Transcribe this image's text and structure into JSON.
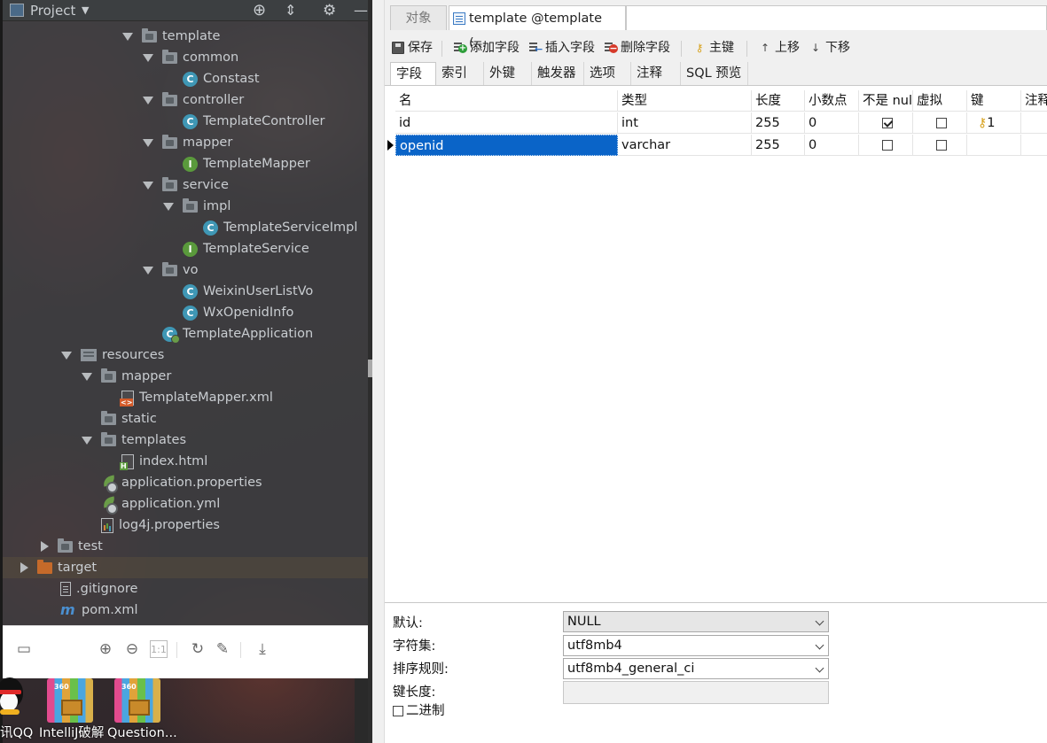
{
  "project_panel": {
    "title": "Project",
    "tree": [
      {
        "label": "template",
        "indent": 6,
        "toggle": "open",
        "icon": "folder-icon"
      },
      {
        "label": "common",
        "indent": 7,
        "toggle": "open",
        "icon": "folder-icon"
      },
      {
        "label": "Constast",
        "indent": 8,
        "toggle": "none",
        "icon": "class-icon"
      },
      {
        "label": "controller",
        "indent": 7,
        "toggle": "open",
        "icon": "folder-icon"
      },
      {
        "label": "TemplateController",
        "indent": 8,
        "toggle": "none",
        "icon": "class-icon"
      },
      {
        "label": "mapper",
        "indent": 7,
        "toggle": "open",
        "icon": "folder-icon"
      },
      {
        "label": "TemplateMapper",
        "indent": 8,
        "toggle": "none",
        "icon": "interface-icon"
      },
      {
        "label": "service",
        "indent": 7,
        "toggle": "open",
        "icon": "folder-icon"
      },
      {
        "label": "impl",
        "indent": 8,
        "toggle": "open",
        "icon": "folder-icon"
      },
      {
        "label": "TemplateServiceImpl",
        "indent": 9,
        "toggle": "none",
        "icon": "class-icon"
      },
      {
        "label": "TemplateService",
        "indent": 8,
        "toggle": "none",
        "icon": "interface-icon"
      },
      {
        "label": "vo",
        "indent": 7,
        "toggle": "open",
        "icon": "folder-icon"
      },
      {
        "label": "WeixinUserListVo",
        "indent": 8,
        "toggle": "none",
        "icon": "class-icon"
      },
      {
        "label": "WxOpenidInfo",
        "indent": 8,
        "toggle": "none",
        "icon": "class-icon"
      },
      {
        "label": "TemplateApplication",
        "indent": 7,
        "toggle": "none",
        "icon": "spring-app-icon"
      },
      {
        "label": "resources",
        "indent": 3,
        "toggle": "open",
        "icon": "resources-folder-icon"
      },
      {
        "label": "mapper",
        "indent": 4,
        "toggle": "open",
        "icon": "folder-icon"
      },
      {
        "label": "TemplateMapper.xml",
        "indent": 5,
        "toggle": "none",
        "icon": "xml-file-icon"
      },
      {
        "label": "static",
        "indent": 4,
        "toggle": "none",
        "icon": "folder-icon"
      },
      {
        "label": "templates",
        "indent": 4,
        "toggle": "open",
        "icon": "folder-icon"
      },
      {
        "label": "index.html",
        "indent": 5,
        "toggle": "none",
        "icon": "html-file-icon"
      },
      {
        "label": "application.properties",
        "indent": 4,
        "toggle": "none",
        "icon": "spring-config-icon"
      },
      {
        "label": "application.yml",
        "indent": 4,
        "toggle": "none",
        "icon": "spring-config-icon"
      },
      {
        "label": "log4j.properties",
        "indent": 4,
        "toggle": "none",
        "icon": "properties-file-icon"
      },
      {
        "label": "test",
        "indent": 2,
        "toggle": "closed",
        "icon": "folder-icon"
      },
      {
        "label": "target",
        "indent": 1,
        "toggle": "closed",
        "icon": "orange-folder-icon",
        "selected": true
      },
      {
        "label": ".gitignore",
        "indent": 2,
        "toggle": "none",
        "icon": "gitignore-file-icon"
      },
      {
        "label": "pom.xml",
        "indent": 2,
        "toggle": "none",
        "icon": "maven-icon"
      }
    ]
  },
  "desktop": {
    "icons": [
      {
        "label": "讯QQ",
        "icon": "qq-icon"
      },
      {
        "label": "IntelliJ破解",
        "icon": "winrar-icon"
      },
      {
        "label": "Question...",
        "icon": "winrar-icon"
      }
    ]
  },
  "navicat": {
    "tabs": [
      {
        "label": "对象"
      },
      {
        "label": "template @template (..."
      }
    ],
    "toolbar": {
      "save": "保存",
      "add_field": "添加字段",
      "insert_field": "插入字段",
      "delete_field": "删除字段",
      "primary_key": "主键",
      "move_up": "上移",
      "move_down": "下移"
    },
    "subtabs": [
      "字段",
      "索引",
      "外键",
      "触发器",
      "选项",
      "注释",
      "SQL 预览"
    ],
    "grid": {
      "columns": [
        "名",
        "类型",
        "长度",
        "小数点",
        "不是 nul",
        "虚拟",
        "键",
        "注释"
      ],
      "rows": [
        {
          "name": "id",
          "type": "int",
          "length": "255",
          "decimals": "0",
          "not_null": true,
          "virtual": false,
          "key": "1"
        },
        {
          "name": "openid",
          "type": "varchar",
          "length": "255",
          "decimals": "0",
          "not_null": false,
          "virtual": false,
          "key": "",
          "selected": true
        }
      ]
    },
    "properties": {
      "default_label": "默认:",
      "default_value": "NULL",
      "charset_label": "字符集:",
      "charset_value": "utf8mb4",
      "collation_label": "排序规则:",
      "collation_value": "utf8mb4_general_ci",
      "key_length_label": "键长度:",
      "binary_label": "二进制"
    }
  }
}
